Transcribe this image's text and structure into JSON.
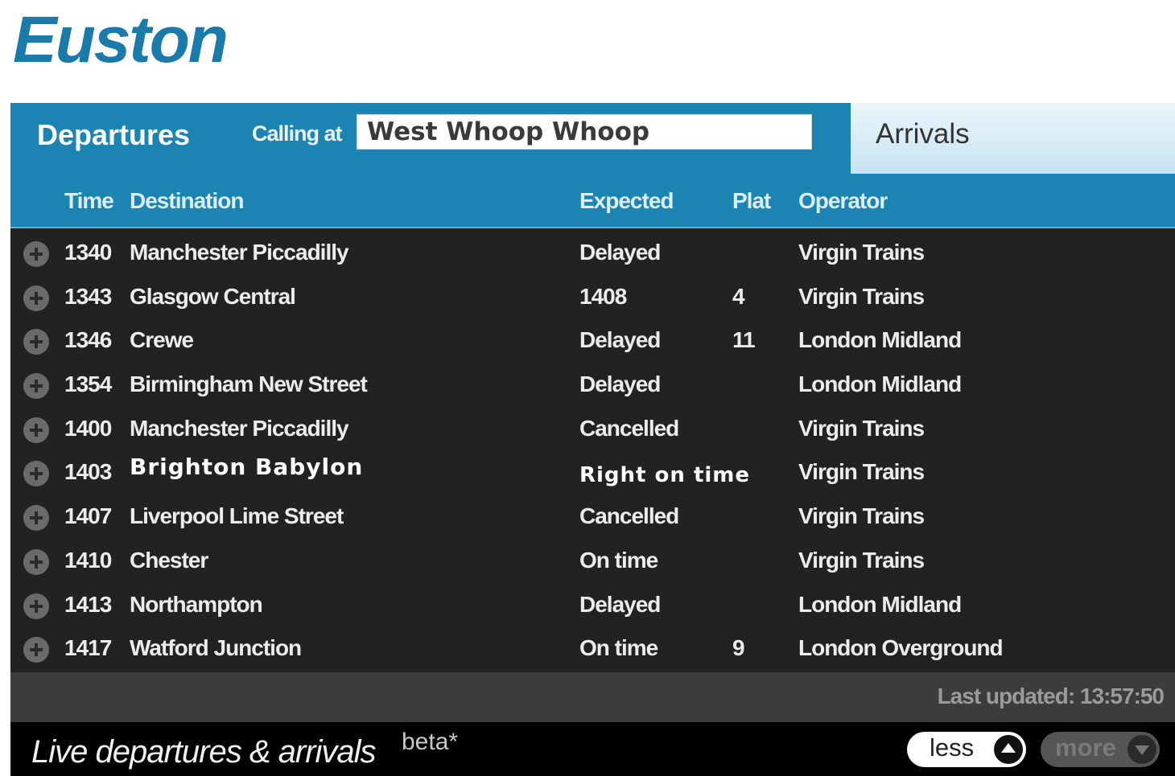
{
  "station": {
    "title": "Euston"
  },
  "tabs": {
    "departures_label": "Departures",
    "calling_at_label": "Calling at",
    "calling_at_value": "West Whoop Whoop",
    "arrivals_label": "Arrivals"
  },
  "columns": {
    "time": "Time",
    "destination": "Destination",
    "expected": "Expected",
    "platform": "Plat",
    "operator": "Operator"
  },
  "rows": [
    {
      "time": "1340",
      "destination": "Manchester Piccadilly",
      "expected": "Delayed",
      "platform": "",
      "operator": "Virgin Trains"
    },
    {
      "time": "1343",
      "destination": "Glasgow Central",
      "expected": "1408",
      "platform": "4",
      "operator": "Virgin Trains"
    },
    {
      "time": "1346",
      "destination": "Crewe",
      "expected": "Delayed",
      "platform": "11",
      "operator": "London Midland"
    },
    {
      "time": "1354",
      "destination": "Birmingham New Street",
      "expected": "Delayed",
      "platform": "",
      "operator": "London Midland"
    },
    {
      "time": "1400",
      "destination": "Manchester Piccadilly",
      "expected": "Cancelled",
      "platform": "",
      "operator": "Virgin Trains"
    },
    {
      "time": "1403",
      "destination": "Brighton Babylon",
      "expected": "Right on time",
      "platform": "",
      "operator": "Virgin Trains"
    },
    {
      "time": "1407",
      "destination": "Liverpool Lime Street",
      "expected": "Cancelled",
      "platform": "",
      "operator": "Virgin Trains"
    },
    {
      "time": "1410",
      "destination": "Chester",
      "expected": "On time",
      "platform": "",
      "operator": "Virgin Trains"
    },
    {
      "time": "1413",
      "destination": "Northampton",
      "expected": "Delayed",
      "platform": "",
      "operator": "London Midland"
    },
    {
      "time": "1417",
      "destination": "Watford Junction",
      "expected": "On time",
      "platform": "9",
      "operator": "London Overground"
    }
  ],
  "status": {
    "last_updated": "Last updated: 13:57:50"
  },
  "footer": {
    "title": "Live departures & arrivals",
    "beta": "beta*",
    "less_label": "less",
    "more_label": "more"
  },
  "icons": {
    "row_expand": "plus-circle-icon",
    "less": "chevron-up-icon",
    "more": "chevron-down-icon"
  },
  "colors": {
    "accent": "#1b84b3",
    "title": "#1a7aaa",
    "board_bg": "#222222"
  }
}
